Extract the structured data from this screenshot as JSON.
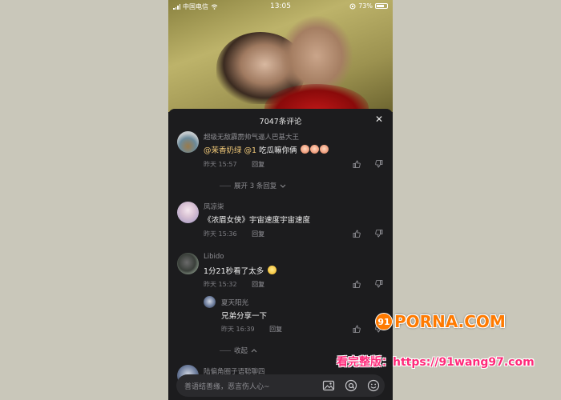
{
  "status_bar": {
    "carrier": "中国电信",
    "time": "13:05",
    "battery": "73%",
    "battery_level": 0.73
  },
  "sheet": {
    "title": "7047条评论",
    "close_icon": "close-icon"
  },
  "comments": [
    {
      "name": "超级无敌霹雳帅气逼人巴基大王",
      "mention1": "@茉香奶绿",
      "mention2": "@1",
      "text": "吃瓜嘛你俩",
      "time": "昨天 15:57",
      "reply": "回复"
    },
    {
      "name": "凤凉柒",
      "text": "《浓眉女侠》宇宙速度宇宙速度",
      "time": "昨天 15:36",
      "reply": "回复"
    },
    {
      "name": "Libido",
      "text": "1分21秒看了太多",
      "time": "昨天 15:32",
      "reply": "回复"
    }
  ],
  "expand_replies": "展开 3 条回复",
  "sub_reply": {
    "name": "夏天阳光",
    "text": "兄弟分享一下",
    "time": "昨天 16:39",
    "reply": "回复"
  },
  "collapse": "收起",
  "partial_name": "陆偏角圈子语聪聊四",
  "input": {
    "placeholder": "善语结善缘，恶言伤人心~"
  },
  "watermark": {
    "logo": "PORNA.COM",
    "badge": "91",
    "url": "看完整版：https://91wang97.com"
  }
}
